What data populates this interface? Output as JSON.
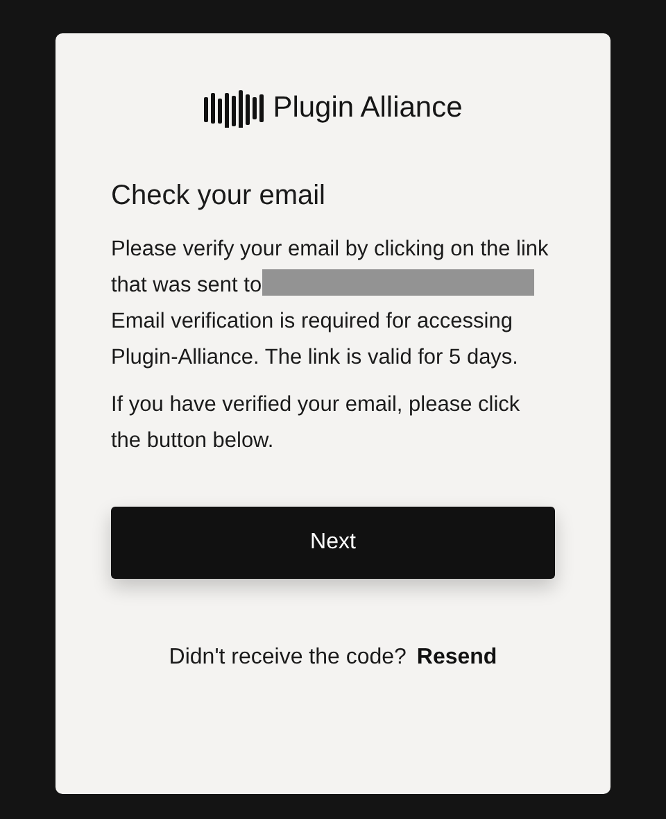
{
  "logo": {
    "text": "Plugin Alliance"
  },
  "heading": "Check your email",
  "message": {
    "before": "Please verify your email by clicking on the link that was sent to",
    "redacted": true,
    "after": "Email verification is required for accessing Plugin-Alliance. The link is valid for 5 days."
  },
  "note": "If you have verified your email, please click the button below.",
  "button": "Next",
  "footer": {
    "text": "Didn't receive the code?",
    "link": "Resend"
  }
}
